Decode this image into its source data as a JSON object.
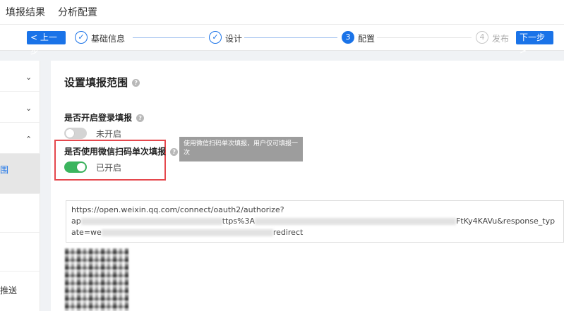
{
  "top_tabs": {
    "result": "填报结果",
    "analysis": "分析配置"
  },
  "steps": {
    "prev_label": "上一步",
    "next_label": "下一步",
    "items": [
      {
        "number": "✓",
        "label": "基础信息",
        "state": "done"
      },
      {
        "number": "✓",
        "label": "设计",
        "state": "done"
      },
      {
        "number": "3",
        "label": "配置",
        "state": "active"
      },
      {
        "number": "4",
        "label": "发布",
        "state": "pending"
      }
    ]
  },
  "sidebar": {
    "partial_item_label": "围",
    "bottom_label": "推送"
  },
  "main": {
    "section_title": "设置填报范围",
    "login_fill": {
      "label": "是否开启登录填报",
      "status": "未开启",
      "enabled": false
    },
    "wechat_fill": {
      "label": "是否使用微信扫码单次填报",
      "status": "已开启",
      "enabled": true
    },
    "tooltip": "使用微信扫码单次填报，用户仅可填报一次",
    "url": {
      "line1": "https://open.weixin.qq.com/connect/oauth2/authorize?",
      "line2_start": "ap",
      "line2_mid": "ttps%3A",
      "line2_end": "FtKy4KAVu&response_typ",
      "line3_start": "ate=we",
      "line3_end": "redirect"
    }
  },
  "colors": {
    "primary": "#1a73e8",
    "toggle_on": "#3bb55e",
    "highlight": "#e5484d"
  }
}
